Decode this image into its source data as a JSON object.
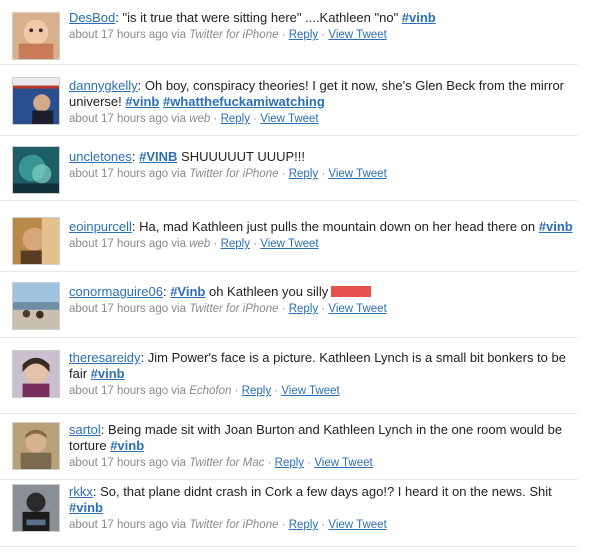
{
  "tweets": [
    {
      "user": "DesBod",
      "parts": [
        ": \"is it true that were sitting here\" ....Kathleen \"no\" ",
        "#vinb"
      ],
      "meta": {
        "time": "about 17 hours ago via",
        "via": "Twitter for iPhone",
        "sep": "·",
        "reply": "Reply",
        "view": "View Tweet"
      }
    },
    {
      "user": "dannygkelly",
      "parts": [
        ": Oh boy, conspiracy theories! I get it now, she's Glen Beck from the mirror universe! ",
        "#vinb",
        " ",
        "#whatthefuckamiwatching"
      ],
      "meta": {
        "time": "about 17 hours ago via",
        "via": "web",
        "sep": "·",
        "reply": "Reply",
        "view": "View Tweet"
      }
    },
    {
      "user": "uncletones",
      "parts": [
        ": ",
        "#VINB",
        " SHUUUUUT UUUP!!!"
      ],
      "meta": {
        "time": "about 17 hours ago via",
        "via": "Twitter for iPhone",
        "sep": "·",
        "reply": "Reply",
        "view": "View Tweet"
      }
    },
    {
      "user": "eoinpurcell",
      "parts": [
        ": Ha, mad Kathleen just pulls the mountain down on her head there on ",
        "#vinb"
      ],
      "meta": {
        "time": "about 17 hours ago via",
        "via": "web",
        "sep": "·",
        "reply": "Reply",
        "view": "View Tweet"
      }
    },
    {
      "user": "conormaguire06",
      "parts": [
        ": ",
        "#Vinb",
        " oh Kathleen you silly"
      ],
      "meta": {
        "time": "about 17 hours ago via",
        "via": "Twitter for iPhone",
        "sep": "·",
        "reply": "Reply",
        "view": "View Tweet"
      }
    },
    {
      "user": "theresareidy",
      "parts": [
        ": Jim Power's face is a picture. Kathleen Lynch is a small bit bonkers to be fair ",
        "#vinb"
      ],
      "meta": {
        "time": "about 17 hours ago via",
        "via": "Echofon",
        "sep": "·",
        "reply": "Reply",
        "view": "View Tweet"
      }
    },
    {
      "user": "sartol",
      "parts": [
        ": Being made sit with Joan Burton and Kathleen Lynch in the one room would be torture ",
        "#vinb"
      ],
      "meta": {
        "time": "about 17 hours ago via",
        "via": "Twitter for Mac",
        "sep": "·",
        "reply": "Reply",
        "view": "View Tweet"
      }
    },
    {
      "user": "rkkx",
      "parts": [
        ": So, that plane didnt crash in Cork a few days ago!? I heard it on the news. Shit ",
        "#vinb"
      ],
      "meta": {
        "time": "about 17 hours ago via",
        "via": "Twitter for iPhone",
        "sep": "·",
        "reply": "Reply",
        "view": "View Tweet"
      }
    }
  ],
  "colors": {
    "link": "#2b6fb6",
    "meta": "#8a8a8a",
    "redaction": "#e8504b"
  }
}
